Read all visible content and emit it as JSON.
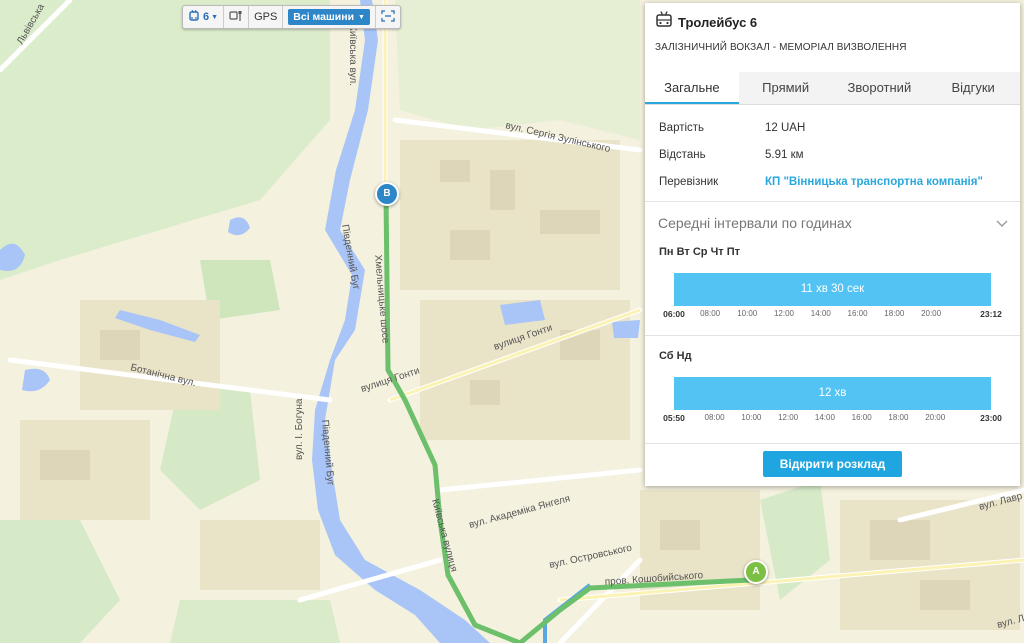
{
  "toolbar": {
    "route_icon": "trolleybus-icon",
    "route_number": "6",
    "stops_icon": "bus-stop-icon",
    "gps_label": "GPS",
    "vehicles_label": "Всі машини",
    "fit_icon": "fit-bounds-icon"
  },
  "panel": {
    "icon": "trolleybus-icon",
    "title": "Тролейбус 6",
    "subtitle": "ЗАЛІЗНИЧНИЙ ВОКЗАЛ - МЕМОРІАЛ ВИЗВОЛЕННЯ",
    "tabs": [
      {
        "label": "Загальне",
        "active": true
      },
      {
        "label": "Прямий",
        "active": false
      },
      {
        "label": "Зворотний",
        "active": false
      },
      {
        "label": "Відгуки",
        "active": false
      }
    ],
    "info": [
      {
        "key": "Вартість",
        "value": "12 UAH"
      },
      {
        "key": "Відстань",
        "value": "5.91 км"
      },
      {
        "key": "Перевізник",
        "value": "КП \"Вінницька транспортна компанія\""
      }
    ],
    "intervals_title": "Середні інтервали по годинах",
    "weekdays": {
      "label": "Пн Вт Ср Чт Пт",
      "bar_text": "11 хв 30 сек",
      "start": "06:00",
      "ticks": [
        "08:00",
        "10:00",
        "12:00",
        "14:00",
        "16:00",
        "18:00",
        "20:00"
      ],
      "end": "23:12"
    },
    "weekend": {
      "label": "Сб Нд",
      "bar_text": "12 хв",
      "start": "05:50",
      "ticks": [
        "08:00",
        "10:00",
        "12:00",
        "14:00",
        "16:00",
        "18:00",
        "20:00"
      ],
      "end": "23:00"
    },
    "open_schedule": "Відкрити розклад"
  },
  "map": {
    "marker_a": "A",
    "marker_b": "B",
    "route_color": "#6cc06b",
    "river_color": "#a9c5f7",
    "street_labels": [
      "вул. Сергія Зулінського",
      "вулиця Гонти",
      "вулиця Гонти",
      "Ботанічна вул.",
      "вул. І. Богуна",
      "Південний Буг",
      "Південний Буг",
      "вул. Академіка Янгеля",
      "вул. Островського",
      "пров. Кошобийського",
      "вул. Лавр",
      "вул. Лавр",
      "Київська вулиця",
      "Хмельницьке шосе",
      "Львівська",
      "Київська вул."
    ]
  }
}
